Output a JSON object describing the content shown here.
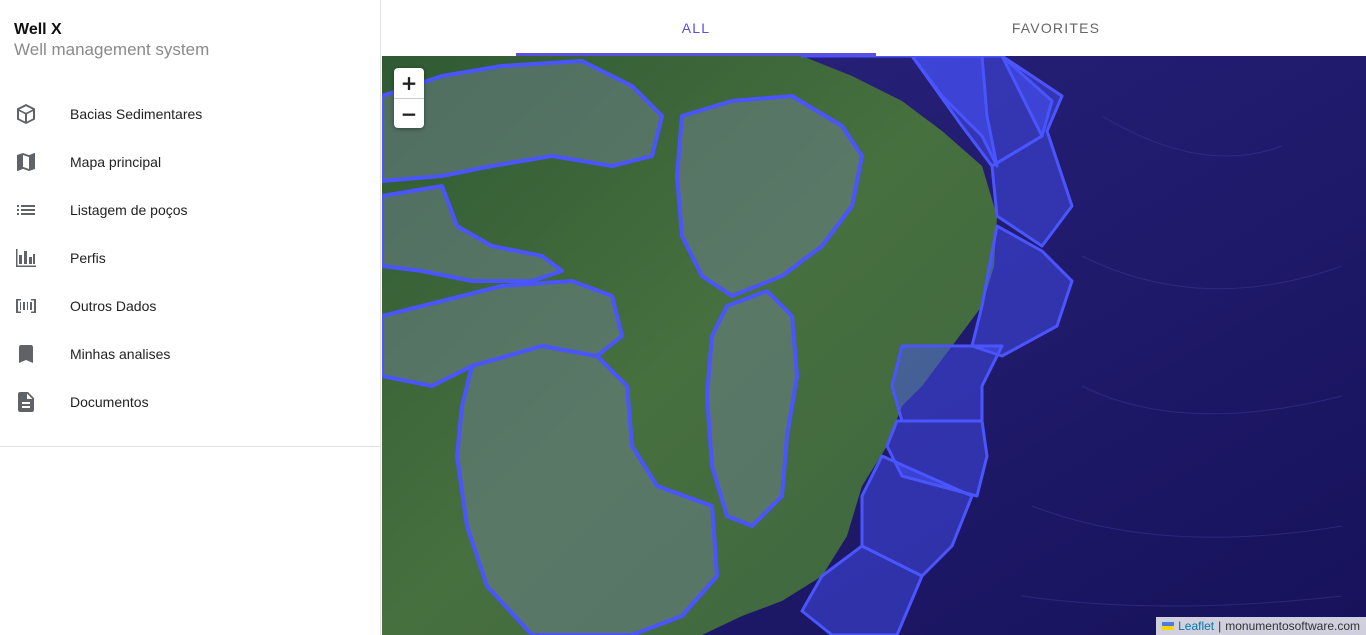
{
  "app": {
    "title": "Well X",
    "subtitle": "Well management system"
  },
  "sidebar": {
    "items": [
      {
        "label": "Bacias Sedimentares",
        "icon": "cube-icon"
      },
      {
        "label": "Mapa principal",
        "icon": "map-icon"
      },
      {
        "label": "Listagem de poços",
        "icon": "list-icon"
      },
      {
        "label": "Perfis",
        "icon": "bar-chart-icon"
      },
      {
        "label": "Outros Dados",
        "icon": "barcode-icon"
      },
      {
        "label": "Minhas analises",
        "icon": "bookmark-icon"
      },
      {
        "label": "Documentos",
        "icon": "document-icon"
      }
    ]
  },
  "tabs": [
    {
      "label": "All",
      "active": true
    },
    {
      "label": "Favorites",
      "active": false
    }
  ],
  "map": {
    "zoom_in": "+",
    "zoom_out": "−",
    "attribution_link": "Leaflet",
    "attribution_separator": "|",
    "attribution_source": "monumentosoftware.com",
    "colors": {
      "accent": "#5b4fe0",
      "polygon_stroke": "#4a55ff",
      "ocean": "#1e1a6e",
      "land": "#3f6b3a"
    }
  }
}
